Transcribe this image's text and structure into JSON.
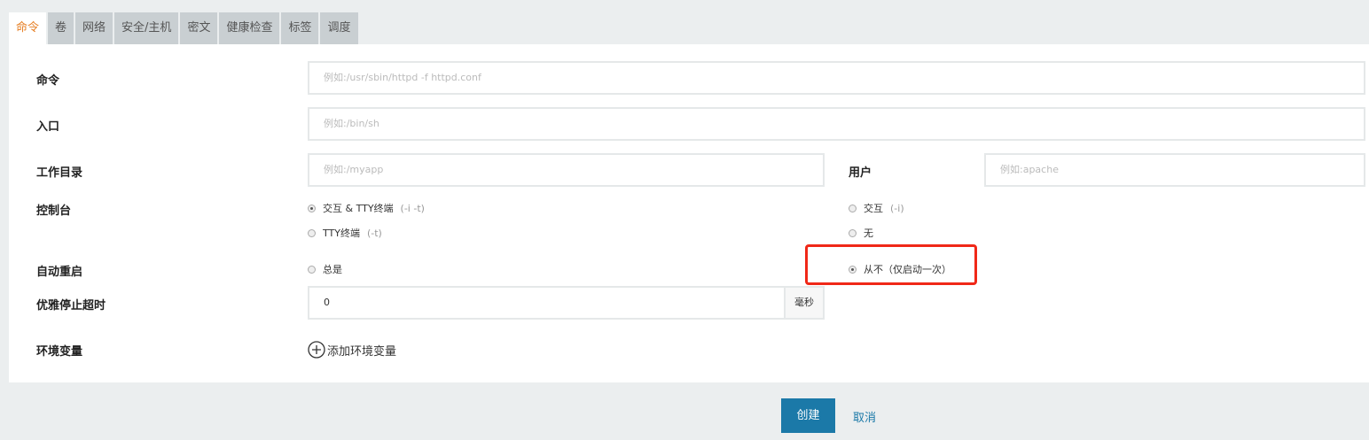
{
  "tabs": [
    "命令",
    "卷",
    "网络",
    "安全/主机",
    "密文",
    "健康检查",
    "标签",
    "调度"
  ],
  "form": {
    "command": {
      "label": "命令",
      "placeholder": "例如:/usr/sbin/httpd -f httpd.conf"
    },
    "entrypoint": {
      "label": "入口",
      "placeholder": "例如:/bin/sh"
    },
    "workdir": {
      "label": "工作目录",
      "placeholder": "例如:/myapp"
    },
    "user": {
      "label": "用户",
      "placeholder": "例如:apache"
    },
    "console": {
      "label": "控制台",
      "options": [
        {
          "label": "交互 & TTY终端",
          "hint": "(-i -t)",
          "checked": true
        },
        {
          "label": "交互",
          "hint": "(-i)",
          "checked": false
        },
        {
          "label": "TTY终端",
          "hint": "(-t)",
          "checked": false
        },
        {
          "label": "无",
          "hint": "",
          "checked": false
        }
      ]
    },
    "restart": {
      "label": "自动重启",
      "options": [
        {
          "label": "总是",
          "checked": false
        },
        {
          "label": "从不（仅启动一次）",
          "checked": true
        }
      ]
    },
    "timeout": {
      "label": "优雅停止超时",
      "value": "0",
      "unit": "毫秒"
    },
    "env": {
      "label": "环境变量",
      "add_label": "添加环境变量"
    }
  },
  "actions": {
    "create": "创建",
    "cancel": "取消"
  },
  "colors": {
    "accent": "#1b79a8",
    "active_tab": "#e67e22",
    "highlight": "#f02818"
  }
}
